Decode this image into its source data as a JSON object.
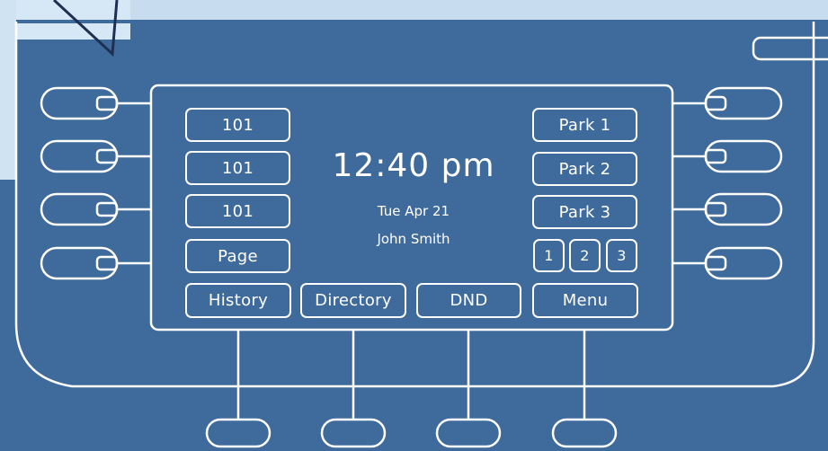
{
  "screen": {
    "time": "12:40 pm",
    "date": "Tue Apr 21",
    "user_name": "John Smith"
  },
  "line_keys_left": [
    {
      "label": "101"
    },
    {
      "label": "101"
    },
    {
      "label": "101"
    },
    {
      "label": "Page"
    }
  ],
  "line_keys_right": [
    {
      "label": "Park 1"
    },
    {
      "label": "Park 2"
    },
    {
      "label": "Park 3"
    }
  ],
  "page_buttons": [
    "1",
    "2",
    "3"
  ],
  "soft_keys": [
    {
      "label": "History"
    },
    {
      "label": "Directory"
    },
    {
      "label": "DND"
    },
    {
      "label": "Menu"
    }
  ],
  "colors": {
    "background": "#3f6a9c",
    "outline": "#ffffff",
    "accent_light_blue": "#cfe3f3"
  }
}
